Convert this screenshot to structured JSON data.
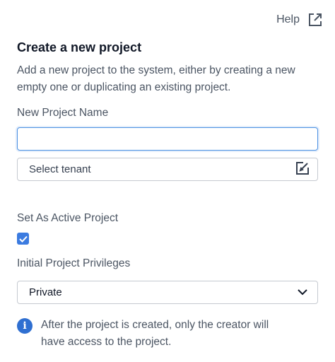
{
  "header": {
    "help_label": "Help",
    "help_icon": "external-link-icon"
  },
  "form": {
    "title": "Create a new project",
    "description": "Add a new project to the system, either by creating a new empty one or duplicating an existing project.",
    "name_label": "New Project Name",
    "name_value": "",
    "tenant_placeholder": "Select tenant",
    "tenant_icon": "edit-icon",
    "active_label": "Set As Active Project",
    "active_checked": true,
    "privileges_label": "Initial Project Privileges",
    "privileges_value": "Private",
    "info_icon": "info-icon",
    "info_text": "After the project is created, only the creator will have access to the project."
  },
  "colors": {
    "accent": "#3b7be0",
    "focus_border": "#4a90e2",
    "info": "#2f6fd1"
  }
}
